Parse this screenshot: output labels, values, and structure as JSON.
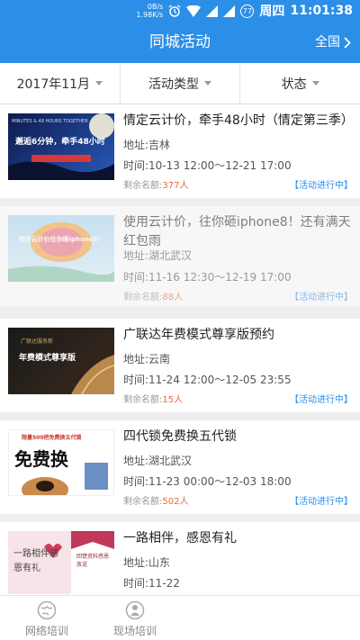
{
  "status_bar": {
    "speed_top": "0B/s",
    "speed_bottom": "1.98K/s",
    "battery": "77",
    "day": "周四",
    "time": "11:01:38"
  },
  "header": {
    "title": "同城活动",
    "region_label": "全国"
  },
  "filters": {
    "month": "2017年11月",
    "type": "活动类型",
    "status": "状态"
  },
  "events": [
    {
      "title": "情定云计价，牵手48小时（情定第三季）",
      "address": "地址:吉林",
      "time": "时间:10-13 12:00～12-21 17:00",
      "remain_label": "剩余名额:",
      "remain_value": "377人",
      "status": "【活动进行中】",
      "thumb_text": "邂逅6分钟，牵手48小时",
      "thumb_sub": "MINUTES & 48 HOURS TOGETHER"
    },
    {
      "title": "使用云计价，往你砸iphone8！还有满天红包雨",
      "address": "地址:湖北武汉",
      "time": "时间:11-16 12:30～12-19 17:00",
      "remain_label": "剩余名额:",
      "remain_value": "88人",
      "status": "【活动进行中】",
      "thumb_text": "使用云计价往你砸iphone8！"
    },
    {
      "title": "广联达年费模式尊享版预约",
      "address": "地址:云南",
      "time": "时间:11-24 12:00～12-05 23:55",
      "remain_label": "剩余名额:",
      "remain_value": "15人",
      "status": "【活动进行中】",
      "thumb_text": "年费模式尊享版",
      "thumb_sub": "广联达服务新"
    },
    {
      "title": "四代锁免费换五代锁",
      "address": "地址:湖北武汉",
      "time": "时间:11-23 00:00～12-03 18:00",
      "remain_label": "剩余名额:",
      "remain_value": "502人",
      "status": "【活动进行中】",
      "thumb_text": "免费换",
      "thumb_sub": "限量500把免费换五代锁"
    },
    {
      "title": "一路相伴，感恩有礼",
      "address": "地址:山东",
      "time": "时间:11-22",
      "thumb_text": "一路相伴感恩有礼",
      "thumb_sub": "回馈资料感恩放送"
    }
  ],
  "bottom_nav": [
    {
      "label": "网络培训",
      "icon": "globe-icon"
    },
    {
      "label": "现场培训",
      "icon": "trainer-icon"
    }
  ],
  "colors": {
    "brand_blue": "#2b8fe8",
    "remain_orange": "#e46a3a"
  }
}
